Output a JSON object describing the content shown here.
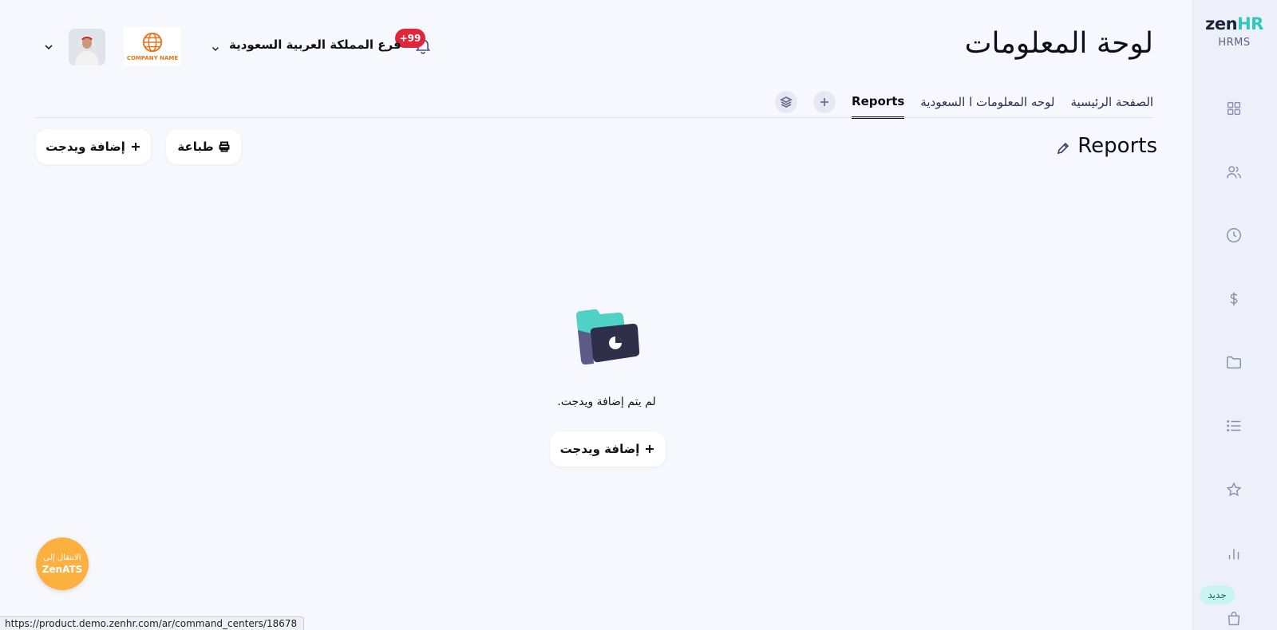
{
  "sidebar": {
    "logo_main_a": "zen",
    "logo_main_b": "HR",
    "logo_sub": "HRMS",
    "items": [
      {
        "icon": "grid-icon"
      },
      {
        "icon": "users-icon"
      },
      {
        "icon": "clock-icon"
      },
      {
        "icon": "dollar-icon"
      },
      {
        "icon": "folder-icon"
      },
      {
        "icon": "list-icon"
      },
      {
        "icon": "star-icon"
      },
      {
        "icon": "bar-chart-icon"
      },
      {
        "icon": "bag-icon"
      }
    ],
    "new_badge": "جديد"
  },
  "header": {
    "title": "لوحة المعلومات",
    "notifications_count": "+99",
    "branch": "فرع المملكة العربية السعودية",
    "company_logo_text": "COMPANY NAME"
  },
  "tabs": [
    {
      "label": "الصفحة الرئيسية",
      "active": false
    },
    {
      "label": "لوحه المعلومات ا السعودية",
      "active": false
    },
    {
      "label": "Reports",
      "active": true
    }
  ],
  "section": {
    "title": "Reports",
    "print_label": "طباعة",
    "add_widget_label": "إضافة ويدجت"
  },
  "empty_state": {
    "message": ".لم يتم إضافة ويدجت",
    "add_widget_label": "إضافة ويدجت"
  },
  "floating": {
    "line1": "الانتقال إلى",
    "line2": "ZenATS"
  },
  "statusbar": {
    "url": "https://product.demo.zenhr.com/ar/command_centers/18678"
  },
  "colors": {
    "accent_teal": "#2fc8c0",
    "notification_red": "#e0263a",
    "floating_orange": "#fbb040",
    "background": "#f7f8fd"
  }
}
